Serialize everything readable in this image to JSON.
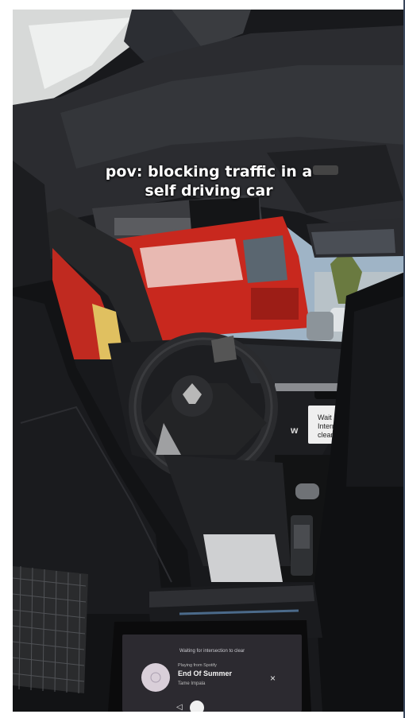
{
  "caption": {
    "line1": "pov: blocking traffic in a",
    "line2": "self driving car"
  },
  "dash_screen": {
    "line1": "Wait",
    "line2": "Intern",
    "line3": "clear"
  },
  "rear_screen": {
    "status": "Waiting for intersection to clear",
    "source": "Playing from Spotify",
    "track": "End Of Summer",
    "artist": "Tame Impala",
    "close": "×",
    "prev": "◁"
  },
  "colors": {
    "bus_red": "#c8281e",
    "interior": "#1a1c20",
    "headliner": "#2a2c30"
  }
}
